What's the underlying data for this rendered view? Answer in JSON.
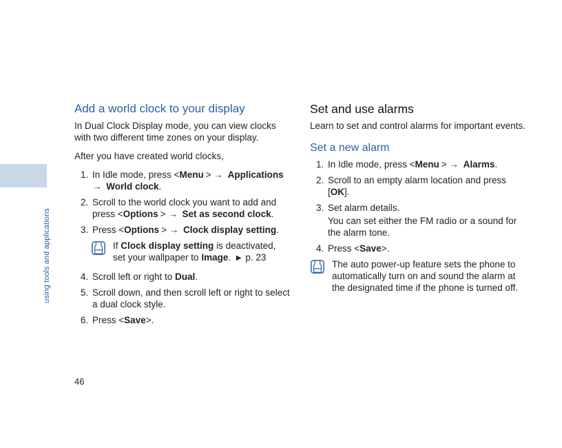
{
  "side_label": "using tools and applications",
  "page_number": "46",
  "left": {
    "heading": "Add a world clock to your display",
    "intro1": "In Dual Clock Display mode, you can view clocks with two different time zones on your display.",
    "intro2": "After you have created world clocks,",
    "steps": {
      "s1_pre": "In Idle mode, press <",
      "s1_menu": "Menu",
      "s1_arrow1": "> → ",
      "s1_applications": "Applications",
      "s1_arrow2": " → ",
      "s1_worldclock": "World clock",
      "s1_post": ".",
      "s2_pre": "Scroll to the world clock you want to add and press <",
      "s2_options": "Options",
      "s2_arrow": "> → ",
      "s2_second": "Set as second clock",
      "s2_post": ".",
      "s3_pre": "Press <",
      "s3_options": "Options",
      "s3_arrow": "> → ",
      "s3_cds": "Clock display setting",
      "s3_post": ".",
      "s4_pre": "Scroll left or right to ",
      "s4_dual": "Dual",
      "s4_post": ".",
      "s5": "Scroll down, and then scroll left or right to select a dual clock style.",
      "s6_pre": "Press <",
      "s6_save": "Save",
      "s6_post": ">."
    },
    "note": {
      "pre": "If ",
      "cds": "Clock display setting",
      "mid": " is deactivated, set your wallpaper to ",
      "image": "Image",
      "post1": ". ",
      "tri": "▶",
      "post2": " p. 23"
    }
  },
  "right": {
    "heading": "Set and use alarms",
    "intro": "Learn to set and control alarms for important events.",
    "subheading": "Set a new alarm",
    "steps": {
      "s1_pre": "In Idle mode, press <",
      "s1_menu": "Menu",
      "s1_arrow": "> → ",
      "s1_alarms": "Alarms",
      "s1_post": ".",
      "s2_pre": "Scroll to an empty alarm location and press [",
      "s2_ok": "OK",
      "s2_post": "].",
      "s3_line1": "Set alarm details.",
      "s3_line2": "You can set either the FM radio or a sound for the alarm tone.",
      "s4_pre": "Press <",
      "s4_save": "Save",
      "s4_post": ">."
    },
    "note": "The auto power-up feature sets the phone to automatically turn on and sound the alarm at the designated time if the phone is turned off."
  }
}
